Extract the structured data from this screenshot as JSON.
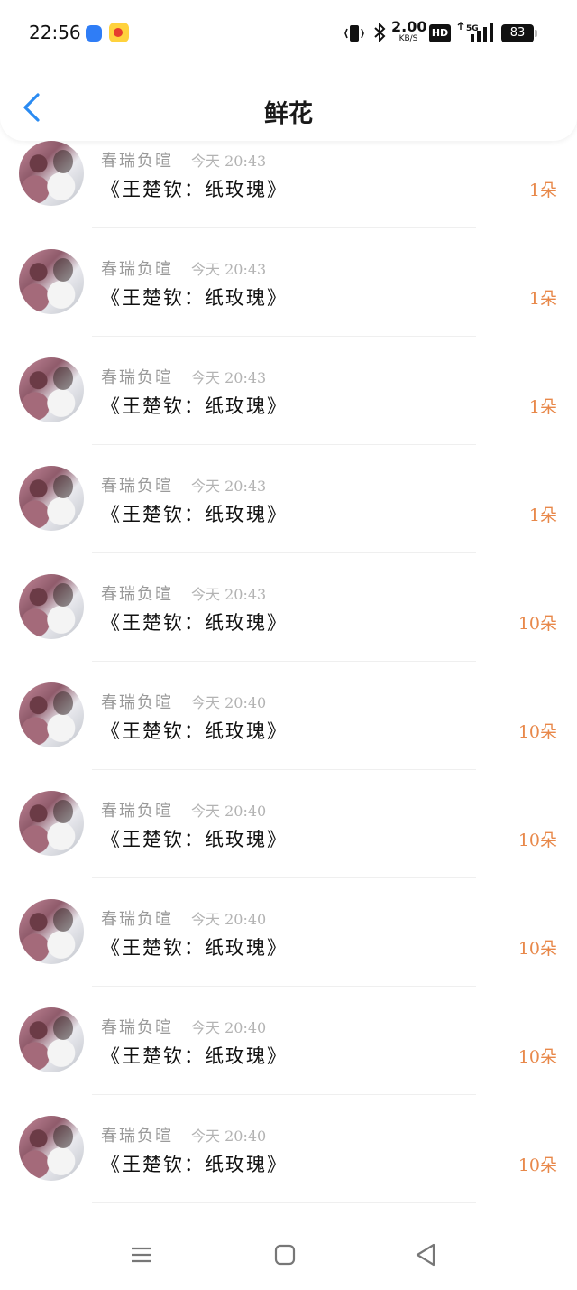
{
  "status_bar": {
    "time": "22:56",
    "net_speed": "2.00",
    "net_unit": "KB/S",
    "hd_label": "HD",
    "network_type": "5G",
    "battery": "83"
  },
  "header": {
    "title": "鲜花",
    "back_icon": "chevron-left-icon"
  },
  "records": [
    {
      "name": "春瑞负暄",
      "time": "今天 20:43",
      "gift": "《王楚钦：纸玫瑰》",
      "count": "1朵"
    },
    {
      "name": "春瑞负暄",
      "time": "今天 20:43",
      "gift": "《王楚钦：纸玫瑰》",
      "count": "1朵"
    },
    {
      "name": "春瑞负暄",
      "time": "今天 20:43",
      "gift": "《王楚钦：纸玫瑰》",
      "count": "1朵"
    },
    {
      "name": "春瑞负暄",
      "time": "今天 20:43",
      "gift": "《王楚钦：纸玫瑰》",
      "count": "1朵"
    },
    {
      "name": "春瑞负暄",
      "time": "今天 20:43",
      "gift": "《王楚钦：纸玫瑰》",
      "count": "10朵"
    },
    {
      "name": "春瑞负暄",
      "time": "今天 20:40",
      "gift": "《王楚钦：纸玫瑰》",
      "count": "10朵"
    },
    {
      "name": "春瑞负暄",
      "time": "今天 20:40",
      "gift": "《王楚钦：纸玫瑰》",
      "count": "10朵"
    },
    {
      "name": "春瑞负暄",
      "time": "今天 20:40",
      "gift": "《王楚钦：纸玫瑰》",
      "count": "10朵"
    },
    {
      "name": "春瑞负暄",
      "time": "今天 20:40",
      "gift": "《王楚钦：纸玫瑰》",
      "count": "10朵"
    },
    {
      "name": "春瑞负暄",
      "time": "今天 20:40",
      "gift": "《王楚钦：纸玫瑰》",
      "count": "10朵"
    }
  ],
  "colors": {
    "accent_blue": "#2a8bf2",
    "count_orange": "#e8884a"
  },
  "system_nav": {
    "menu_icon": "menu-icon",
    "home_icon": "home-square-icon",
    "back_icon": "back-triangle-icon"
  }
}
